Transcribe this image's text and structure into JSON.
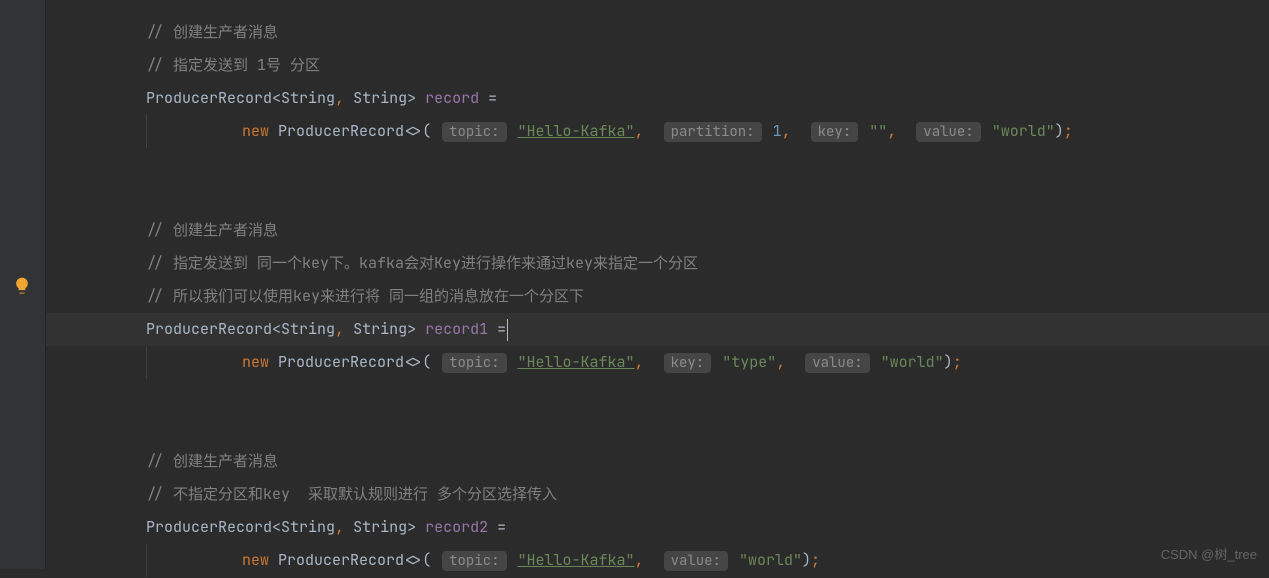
{
  "watermark": "CSDN @树_tree",
  "blocks": [
    {
      "comments": [
        "// 创建生产者消息",
        "// 指定发送到 1号 分区"
      ],
      "declType": "ProducerRecord<String, String>",
      "varName": "record",
      "eq": "=",
      "kw_new": "new",
      "ctor": "ProducerRecord<>(",
      "args": [
        {
          "hint": "topic:",
          "value": "\"Hello-Kafka\"",
          "type": "strlink"
        },
        {
          "hint": "partition:",
          "value": "1",
          "type": "num"
        },
        {
          "hint": "key:",
          "value": "\"\"",
          "type": "str"
        },
        {
          "hint": "value:",
          "value": "\"world\"",
          "type": "str"
        }
      ],
      "close": ");"
    },
    {
      "comments": [
        "// 创建生产者消息",
        "// 指定发送到 同一个key下。kafka会对Key进行操作来通过key来指定一个分区",
        "// 所以我们可以使用key来进行将 同一组的消息放在一个分区下"
      ],
      "declType": "ProducerRecord<String, String>",
      "varName": "record1",
      "eq": "=",
      "kw_new": "new",
      "ctor": "ProducerRecord<>(",
      "highlight": true,
      "args": [
        {
          "hint": "topic:",
          "value": "\"Hello-Kafka\"",
          "type": "strlink"
        },
        {
          "hint": "key:",
          "value": "\"type\"",
          "type": "str"
        },
        {
          "hint": "value:",
          "value": "\"world\"",
          "type": "str"
        }
      ],
      "close": ");"
    },
    {
      "comments": [
        "// 创建生产者消息",
        "// 不指定分区和key  采取默认规则进行 多个分区选择传入"
      ],
      "declType": "ProducerRecord<String, String>",
      "varName": "record2",
      "eq": "=",
      "kw_new": "new",
      "ctor": "ProducerRecord<>(",
      "args": [
        {
          "hint": "topic:",
          "value": "\"Hello-Kafka\"",
          "type": "strlink"
        },
        {
          "hint": "value:",
          "value": "\"world\"",
          "type": "str"
        }
      ],
      "close": ");"
    }
  ]
}
